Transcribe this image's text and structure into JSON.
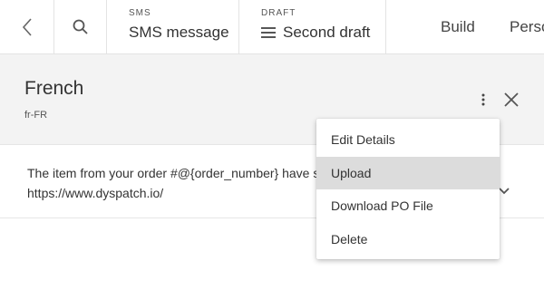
{
  "topbar": {
    "sms_section_label": "SMS",
    "sms_section_value": "SMS message",
    "draft_section_label": "DRAFT",
    "draft_section_value": "Second draft",
    "tabs": [
      {
        "label": "Build"
      },
      {
        "label": "Perso"
      }
    ]
  },
  "language": {
    "name": "French",
    "code": "fr-FR"
  },
  "message": {
    "line1": "The item from your order #@{order_number} have sh",
    "line2": "https://www.dyspatch.io/"
  },
  "menu": {
    "items": [
      {
        "label": "Edit Details"
      },
      {
        "label": "Upload"
      },
      {
        "label": "Download PO File"
      },
      {
        "label": "Delete"
      }
    ],
    "highlighted_item": "Upload"
  },
  "icons": {
    "back": "chevron-left-icon",
    "search": "search-icon",
    "menu": "hamburger-icon",
    "more": "kebab-icon",
    "close": "close-icon",
    "expand": "chevron-down-icon"
  },
  "colors": {
    "header_bg": "#f3f3f3",
    "menu_highlight": "#dcdcdc",
    "text": "#333333"
  }
}
